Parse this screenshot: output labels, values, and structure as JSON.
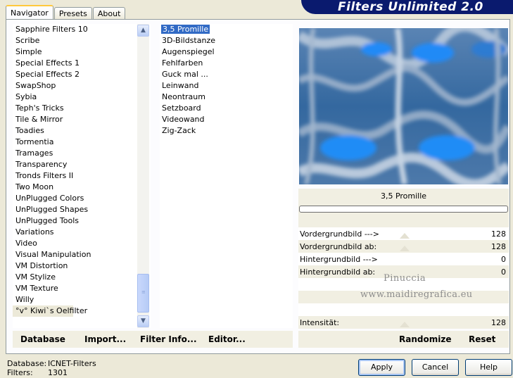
{
  "header": {
    "title": "Filters Unlimited 2.0"
  },
  "tabs": [
    {
      "label": "Navigator",
      "active": true
    },
    {
      "label": "Presets",
      "active": false
    },
    {
      "label": "About",
      "active": false
    }
  ],
  "categories": [
    "Sapphire Filters 10",
    "Scribe",
    "Simple",
    "Special Effects 1",
    "Special Effects 2",
    "SwapShop",
    "Sybia",
    "Teph's Tricks",
    "Tile & Mirror",
    "Toadies",
    "Tormentia",
    "Tramages",
    "Transparency",
    "Tronds Filters II",
    "Two Moon",
    "UnPlugged Colors",
    "UnPlugged Shapes",
    "UnPlugged Tools",
    "Variations",
    "Video",
    "Visual Manipulation",
    "VM Distortion",
    "VM Stylize",
    "VM Texture",
    "Willy",
    "°v° Kiwi`s Oelfilter"
  ],
  "selected_category": "°v° Kiwi`s Oelfilter",
  "filters": [
    "3,5 Promille",
    "3D-Bildstanze",
    "Augenspiegel",
    "Fehlfarben",
    "Guck mal ...",
    "Leinwand",
    "Neontraum",
    "Setzboard",
    "Videowand",
    "Zig-Zack"
  ],
  "selected_filter": "3,5 Promille",
  "filter_name": "3,5 Promille",
  "params": [
    {
      "label": "Vordergrundbild --->",
      "value": "128",
      "level": 0.5
    },
    {
      "label": "Vordergrundbild ab:",
      "value": "128",
      "level": 0.5
    },
    {
      "label": "Hintergrundbild --->",
      "value": "0",
      "level": 0
    },
    {
      "label": "Hintergrundbild ab:",
      "value": "0",
      "level": 0
    },
    {
      "label": "Intensität:",
      "value": "128",
      "level": 0.5
    }
  ],
  "watermark": {
    "line1": "Pinuccia",
    "line2": "www.maidiregrafica.eu"
  },
  "bottom_links": {
    "database": "Database",
    "import": "Import...",
    "filter_info": "Filter Info...",
    "editor": "Editor...",
    "randomize": "Randomize",
    "reset": "Reset"
  },
  "footer": {
    "database_label": "Database:",
    "database_value": "ICNET-Filters",
    "filters_label": "Filters:",
    "filters_value": "1301"
  },
  "buttons": {
    "apply": "Apply",
    "cancel": "Cancel",
    "help": "Help"
  }
}
